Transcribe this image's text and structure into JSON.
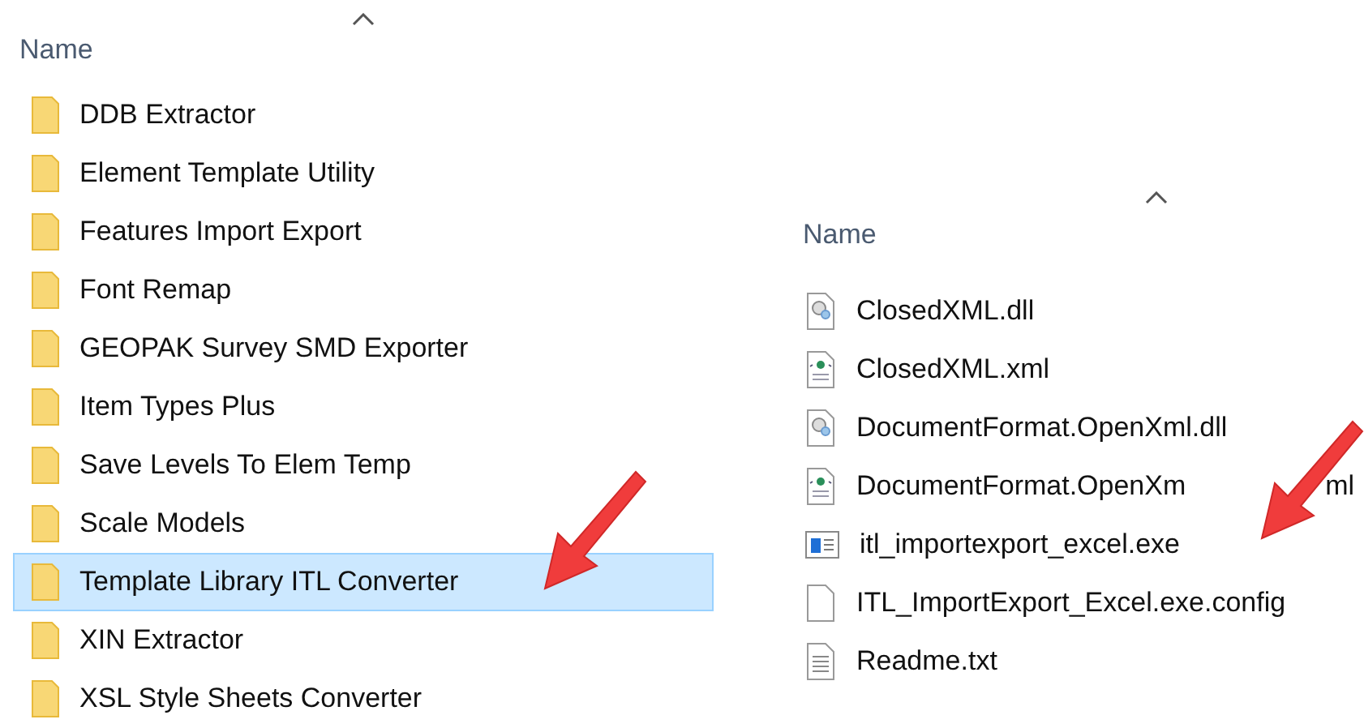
{
  "left_pane": {
    "column_header": "Name",
    "items": [
      {
        "name": "DDB Extractor",
        "selected": false
      },
      {
        "name": "Element Template Utility",
        "selected": false
      },
      {
        "name": "Features Import Export",
        "selected": false
      },
      {
        "name": "Font Remap",
        "selected": false
      },
      {
        "name": "GEOPAK Survey SMD Exporter",
        "selected": false
      },
      {
        "name": "Item Types Plus",
        "selected": false
      },
      {
        "name": "Save Levels To Elem Temp",
        "selected": false
      },
      {
        "name": "Scale Models",
        "selected": false
      },
      {
        "name": "Template Library ITL Converter",
        "selected": true
      },
      {
        "name": "XIN Extractor",
        "selected": false
      },
      {
        "name": "XSL Style Sheets Converter",
        "selected": false
      }
    ]
  },
  "right_pane": {
    "column_header": "Name",
    "items": [
      {
        "kind": "dll",
        "name": "ClosedXML.dll"
      },
      {
        "kind": "xml",
        "name": "ClosedXML.xml"
      },
      {
        "kind": "dll",
        "name": "DocumentFormat.OpenXml.dll"
      },
      {
        "kind": "xml",
        "name": "DocumentFormat.OpenXm",
        "name_tail": "ml"
      },
      {
        "kind": "exe",
        "name": "itl_importexport_excel.exe"
      },
      {
        "kind": "config",
        "name": "ITL_ImportExport_Excel.exe.config"
      },
      {
        "kind": "txt",
        "name": "Readme.txt"
      }
    ]
  }
}
